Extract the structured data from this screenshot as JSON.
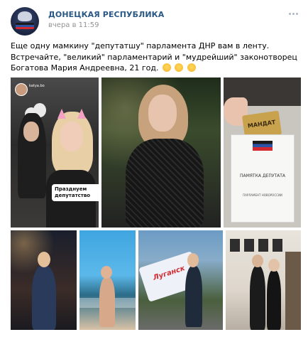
{
  "post": {
    "group_name": "ДОНЕЦКАЯ РЕСПУБЛИКА",
    "time": "вчера в 11:59",
    "text": "Еще одну мамкину \"депутатшу\" парламента ДНР вам в ленту. Встречайте, \"великий\" парламентарий и \"мудрейший\" законотворец Богатова Мария Андреевна, 21 год.",
    "emojis": [
      "grinning-face-emoji",
      "grinning-face-emoji",
      "grinning-face-emoji"
    ]
  },
  "photos": {
    "story": {
      "username": "katya.bo",
      "caption": "Празднуем депутатство"
    },
    "documents": {
      "card_label": "МАНДАТ",
      "booklet_title": "ПАМЯТКА ДЕПУТАТА",
      "booklet_sub": "ПАРЛАМЕНТ НОВОРОССИИ"
    },
    "flag_banner_text": "Луганск"
  },
  "colors": {
    "link": "#2a5885",
    "meta": "#939393"
  }
}
